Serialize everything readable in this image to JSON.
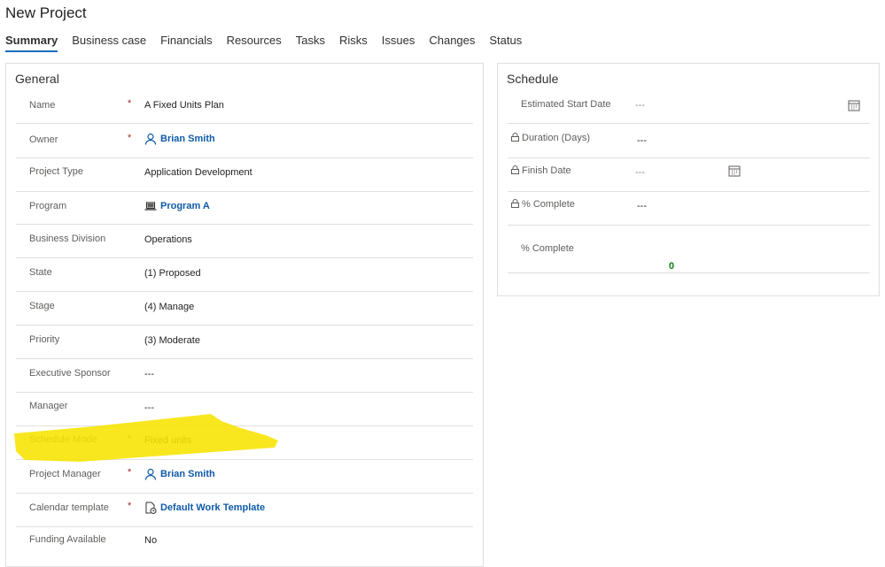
{
  "title": "New Project",
  "tabs": [
    {
      "label": "Summary"
    },
    {
      "label": "Business case"
    },
    {
      "label": "Financials"
    },
    {
      "label": "Resources"
    },
    {
      "label": "Tasks"
    },
    {
      "label": "Risks"
    },
    {
      "label": "Issues"
    },
    {
      "label": "Changes"
    },
    {
      "label": "Status"
    }
  ],
  "general": {
    "title": "General",
    "fields": [
      {
        "label": "Name",
        "required": "*",
        "value": "A Fixed Units Plan"
      },
      {
        "label": "Owner",
        "required": "*",
        "value": "Brian Smith",
        "icon": "person-icon"
      },
      {
        "label": "Project Type",
        "value": "Application Development"
      },
      {
        "label": "Program",
        "value": "Program A",
        "icon": "laptop-icon"
      },
      {
        "label": "Business Division",
        "value": "Operations"
      },
      {
        "label": "State",
        "value": "(1) Proposed"
      },
      {
        "label": "Stage",
        "value": "(4) Manage"
      },
      {
        "label": "Priority",
        "value": "(3) Moderate"
      },
      {
        "label": "Executive Sponsor",
        "value": "---"
      },
      {
        "label": "Manager",
        "value": "---"
      },
      {
        "label": "Schedule Mode",
        "required": "*",
        "value": "Fixed units"
      },
      {
        "label": "Project Manager",
        "required": "*",
        "value": "Brian Smith",
        "icon": "person-icon"
      },
      {
        "label": "Calendar template",
        "required": "*",
        "value": "Default Work Template",
        "icon": "calendar-template-icon"
      },
      {
        "label": "Funding Available",
        "value": "No"
      }
    ]
  },
  "schedule": {
    "title": "Schedule",
    "fields": [
      {
        "label": "Estimated Start Date",
        "value": "---"
      },
      {
        "label": "Duration (Days)",
        "value": "---"
      },
      {
        "label": "Finish Date",
        "value": "---"
      },
      {
        "label": "% Complete",
        "value": "---"
      },
      {
        "label": "% Complete",
        "value": "0"
      }
    ]
  },
  "colors": {
    "accent": "#0f6cbd",
    "link": "#0f5aa8",
    "required": "#a4262c",
    "highlight": "#f7e400",
    "progress_value": "#107c10"
  }
}
